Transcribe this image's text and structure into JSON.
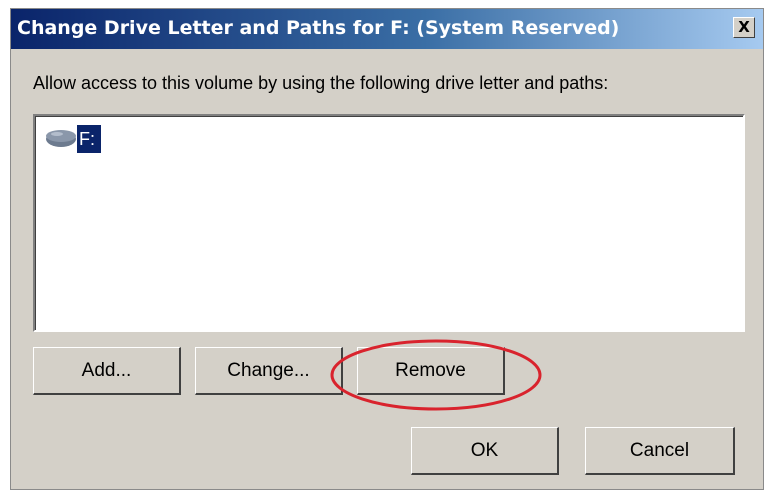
{
  "window": {
    "title": "Change Drive Letter and Paths for F: (System Reserved)",
    "close_label": "X"
  },
  "description": "Allow access to this volume by using the following drive letter and paths:",
  "list": {
    "items": [
      {
        "label": "F:",
        "icon": "drive-icon",
        "selected": true
      }
    ]
  },
  "buttons": {
    "add": "Add...",
    "change": "Change...",
    "remove": "Remove",
    "ok": "OK",
    "cancel": "Cancel"
  },
  "annotation": {
    "shape": "ellipse",
    "color": "#d9232d",
    "target": "remove-button"
  },
  "colors": {
    "dialog_bg": "#d4d0c8",
    "titlebar_start": "#0a246a",
    "titlebar_end": "#a6caf0",
    "selection": "#0a246a"
  }
}
